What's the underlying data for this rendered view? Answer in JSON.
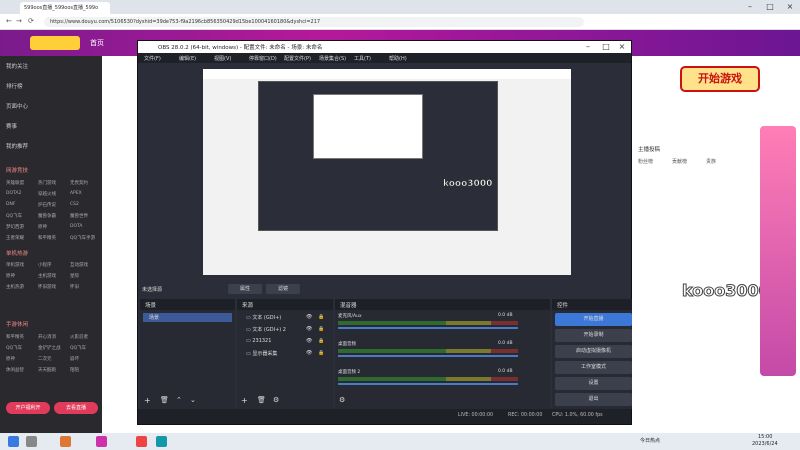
{
  "browser": {
    "tabs": [
      {
        "label": "599oos直播_599oos直播_599o"
      }
    ],
    "url": "https://www.douyu.com/5106530?dyshid=39de753-f9a2196cb856350429d15be10004160180&dyshci=217"
  },
  "site": {
    "home": "首页",
    "start_game": "开始游戏"
  },
  "sidebar": {
    "items": [
      "我的关注",
      "排行榜",
      "页面中心",
      "赛事"
    ],
    "section_recommend": "我的推荐",
    "section_games": "网游竞技",
    "games": [
      [
        "英雄联盟",
        "热门游戏",
        "无畏契约"
      ],
      [
        "DOTA2",
        "穿越火线",
        "APEX"
      ],
      [
        "DNF",
        "炉石传说",
        "CS2"
      ],
      [
        "QQ飞车",
        "魔兽争霸",
        "魔兽世界"
      ],
      [
        "梦幻西游",
        "原神",
        "DOTA"
      ],
      [
        "王者荣耀",
        "和平精英",
        "QQ飞车手游"
      ]
    ],
    "section_mobile": "单机热游",
    "mobile": [
      [
        "单机游戏",
        "小程序",
        "互动游戏"
      ],
      [
        "原神",
        "主机游戏",
        "星际"
      ],
      [
        "主机热游",
        "怀旧游戏",
        "怀旧"
      ]
    ],
    "section_life": "手游休闲",
    "life": [
      [
        "和平精英",
        "开心消消",
        "火影忍者"
      ],
      [
        "QQ飞车",
        "金铲铲之战",
        "QQ飞车"
      ],
      [
        "原神",
        "二次元",
        "崩坏"
      ],
      [
        "休闲益智",
        "天天酷跑",
        "陌陌"
      ]
    ],
    "btn_open": "开户福利开",
    "btn_live": "去看直播"
  },
  "obs": {
    "title": "OBS 28.0.2 (64-bit, windows) - 配置文件: 未命名 - 场景: 未命名",
    "menu": [
      "文件(F)",
      "编辑(E)",
      "视图(V)",
      "停靠窗口(D)",
      "配置文件(P)",
      "场景集合(S)",
      "工具(T)",
      "帮助(H)"
    ],
    "no_source": "未选择源",
    "props_btn": "属性",
    "filters_btn": "滤镜",
    "scenes_title": "场景",
    "scene_items": [
      "场景"
    ],
    "sources_title": "来源",
    "sources": [
      "文本 (GDI+)",
      "文本 (GDI+) 2",
      "231321",
      "显示器采集"
    ],
    "mixer_title": "混音器",
    "mixer": [
      {
        "name": "麦克风/Aux",
        "db": "0.0 dB"
      },
      {
        "name": "桌面音频",
        "db": "0.0 dB"
      },
      {
        "name": "桌面音频 2",
        "db": "0.0 dB"
      }
    ],
    "controls_title": "控件",
    "controls": [
      "开始直播",
      "开始录制",
      "启动虚拟摄像机",
      "工作室模式",
      "设置",
      "退出"
    ],
    "status": {
      "live": "LIVE: 00:00:00",
      "rec": "REC: 00:00:00",
      "cpu": "CPU: 1.0%, 60.00 fps"
    }
  },
  "stream": {
    "overlay_text": "kooo3000"
  },
  "right": {
    "chat_title": "主播投稿",
    "tabs": [
      "粉丝榜",
      "贡献榜",
      "贵族"
    ]
  },
  "taskbar": {
    "weather": "今日热点",
    "time": "15:00",
    "date": "2023/6/24"
  },
  "colors": {
    "accent": "#3c78d8",
    "brand": "#b5199b"
  }
}
